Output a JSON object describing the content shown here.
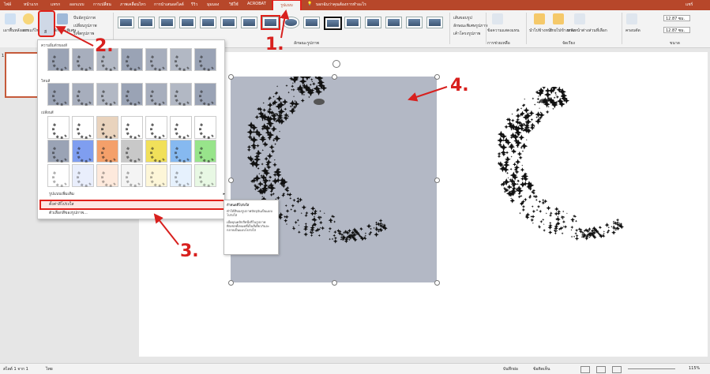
{
  "tabs": [
    "ไฟล์",
    "หน้าแรก",
    "แทรก",
    "ออกแบบ",
    "การเปลี่ยน",
    "ภาพเคลื่อนไหว",
    "การนำเสนอสไลด์",
    "รีวิว",
    "มุมมอง",
    "วิธีใช้",
    "ACROBAT",
    "รูปแบบ"
  ],
  "active_tab": "รูปแบบ",
  "search_hint": "บอกฉันว่าคุณต้องการทำอะไร",
  "user": "แชร์",
  "ribbon": {
    "remove_bg": "เอาพื้นหลังออก",
    "corrections": "การแก้ไข",
    "color": "สี",
    "artistic": "ลักษณะพิเศษ",
    "compress": "บีบอัดรูปภาพ",
    "change": "เปลี่ยนรูปภาพ",
    "reset": "รีเซ็ตรูปภาพ",
    "styles_group": "ลักษณะรูปภาพ",
    "border": "เส้นขอบรูป",
    "effects": "ลักษณะพิเศษรูปภาพ",
    "layout": "เค้าโครงรูปภาพ",
    "alt_text": "ข้อความแสดงแทน",
    "access_group": "การช่วยเหลือ",
    "forward": "นำไปข้างหน้า",
    "backward": "ย้ายไปข้างหลัง",
    "selection": "บานหน้าต่างส่วนที่เลือก",
    "arrange_group": "จัดเรียง",
    "crop": "ครอบตัด",
    "height": "12.87 ซม.",
    "width": "12.87 ซม.",
    "size_group": "ขนาด"
  },
  "gallery": {
    "saturation": "ความอิ่มตัวของสี",
    "tone": "โทนสี",
    "recolor": "เปลี่ยนสี",
    "more_variations": "รูปแบบเพิ่มเติม",
    "set_transparent": "ตั้งค่าสีโปร่งใส",
    "picture_color_options": "ตัวเลือกสีของรูปภาพ..."
  },
  "tooltip": {
    "title": "กำหนดสีโปร่งใส",
    "body1": "ทำให้สีของรูปภาพปัจจุบันเป็นแบบโปร่งใส",
    "body2": "เมื่อคุณคลิกสีหนึ่งสีในรูปภาพ พิกเซลทั้งหมดที่เป็นสีเดียวกันจะกลายเป็นแบบโปร่งใส"
  },
  "slide_number": "1",
  "status": {
    "slide_of": "สไลด์ 1 จาก 1",
    "language": "ไทย",
    "notes": "บันทึกย่อ",
    "comments": "ข้อคิดเห็น",
    "zoom": "115%"
  },
  "annotations": [
    "1.",
    "2.",
    "3.",
    "4."
  ],
  "colors": {
    "accent": "#b7472a",
    "highlight": "#e0211a",
    "picture_bg": "#b3b8c5"
  }
}
